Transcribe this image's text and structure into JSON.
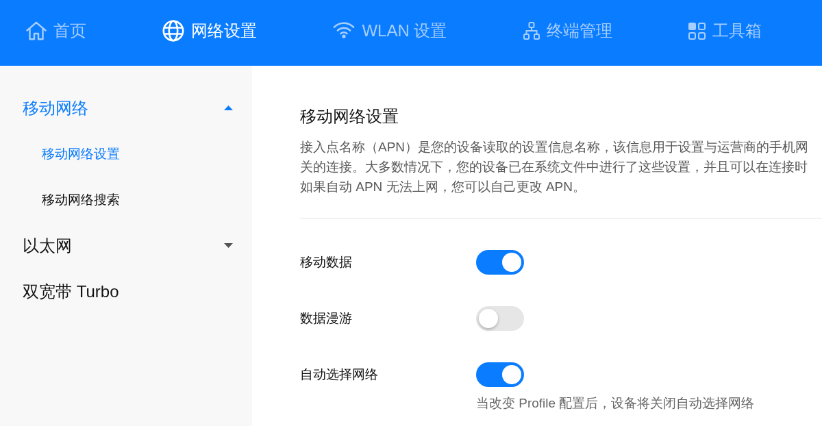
{
  "top_nav": {
    "items": [
      {
        "label": "首页",
        "selected": false
      },
      {
        "label": "网络设置",
        "selected": true
      },
      {
        "label": "WLAN 设置",
        "selected": false
      },
      {
        "label": "终端管理",
        "selected": false
      },
      {
        "label": "工具箱",
        "selected": false
      }
    ]
  },
  "sidebar": {
    "items": [
      {
        "label": "移动网络",
        "selected": true,
        "expanded": true,
        "children": [
          {
            "label": "移动网络设置",
            "selected": true
          },
          {
            "label": "移动网络搜索",
            "selected": false
          }
        ]
      },
      {
        "label": "以太网",
        "selected": false,
        "expanded": false
      },
      {
        "label": "双宽带 Turbo",
        "selected": false
      }
    ]
  },
  "page": {
    "title": "移动网络设置",
    "description_lines": [
      "接入点名称（APN）是您的设备读取的设置信息名称，该信息用于设置与运营商的手机网",
      "关的连接。大多数情况下，您的设备已在系统文件中进行了这些设置，并且可以在连接时",
      "如果自动 APN 无法上网，您可以自己更改 APN。"
    ],
    "settings": [
      {
        "label": "移动数据",
        "on": true
      },
      {
        "label": "数据漫游",
        "on": false
      },
      {
        "label": "自动选择网络",
        "on": true,
        "hint": "当改变 Profile 配置后，设备将关闭自动选择网络"
      }
    ]
  }
}
